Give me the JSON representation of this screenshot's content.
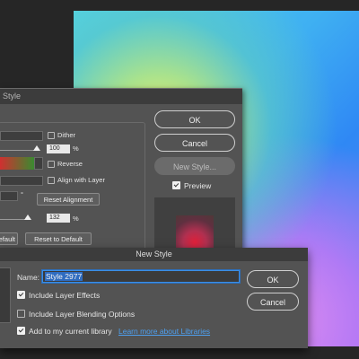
{
  "style_panel": {
    "title_partial": "Style",
    "dither_label": "Dither",
    "opacity_value": "100",
    "opacity_unit": "%",
    "reverse_label": "Reverse",
    "align_label": "Align with Layer",
    "angle_unit": "°",
    "reset_alignment_label": "Reset Alignment",
    "scale_value": "132",
    "scale_unit": "%",
    "make_default_partial": "efault",
    "reset_default_label": "Reset to Default"
  },
  "side_buttons": {
    "ok": "OK",
    "cancel": "Cancel",
    "new_style": "New Style...",
    "preview_label": "Preview"
  },
  "new_style_dialog": {
    "title": "New Style",
    "name_label": "Name:",
    "name_value": "Style 2977",
    "include_effects_label": "Include Layer Effects",
    "include_blending_label": "Include Layer Blending Options",
    "add_library_label": "Add to my current library",
    "learn_more_link": "Learn more about Libraries",
    "ok": "OK",
    "cancel": "Cancel",
    "include_effects_checked": true,
    "include_blending_checked": false,
    "add_library_checked": true
  },
  "colors": {
    "panel_bg": "#535353",
    "titlebar_bg": "#3c3c3c",
    "accent_blue": "#3b8ee6"
  }
}
